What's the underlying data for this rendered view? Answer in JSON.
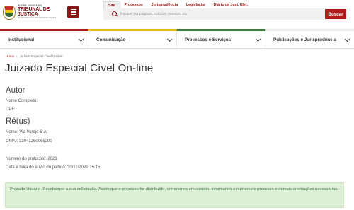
{
  "header": {
    "logo": {
      "small": "PODER JUDICIÁRIO",
      "main": "TRIBUNAL DE JUSTIÇA",
      "sub": "DO ESTADO DO RIO GRANDE DO SUL"
    },
    "tabs": [
      {
        "label": "Site",
        "active": true
      },
      {
        "label": "Processos",
        "active": false
      },
      {
        "label": "Jurisprudência",
        "active": false
      },
      {
        "label": "Legislação",
        "active": false
      },
      {
        "label": "Diário da Just. Elet.",
        "active": false
      }
    ],
    "search": {
      "placeholder": "Busque por páginas, notícias, eventos, etc",
      "value": "",
      "button_label": "Buscar"
    }
  },
  "nav": [
    {
      "label": "Institucional"
    },
    {
      "label": "Comunicação"
    },
    {
      "label": "Processos e Serviços"
    },
    {
      "label": "Publicações e Jurisprudência"
    }
  ],
  "breadcrumb": {
    "home": "Home",
    "separator": "›",
    "current": "Juizado Especial Cível On-line"
  },
  "page_title": "Juizado Especial Cível On-line",
  "autor": {
    "title": "Autor",
    "nome": "Nome Completo:",
    "cpf": "CPF:"
  },
  "reus": {
    "title": "Ré(us)",
    "nome": "Nome: Via Varejo S.A.",
    "cnpj": "CNPJ: 33041260065290"
  },
  "protocolo": {
    "numero": "Número do protocolo: 2021",
    "data": "Data e hora do envio do pedido: 30/11/2021 15:15"
  },
  "alert": {
    "text": "Prezado Usuário. Recebemos a sua solicitação. Assim que o processo for distribuído, entraremos em contato, informando o número do processo e demais orientações necessárias."
  },
  "colors": {
    "brand": "#8c1515",
    "button": "#b11d1d",
    "bar_red": "#b11d1d",
    "bar_yellow": "#e8b820",
    "bar_green": "#3b7d3b",
    "alert_bg": "#dff0d8",
    "alert_text": "#3c763d"
  }
}
